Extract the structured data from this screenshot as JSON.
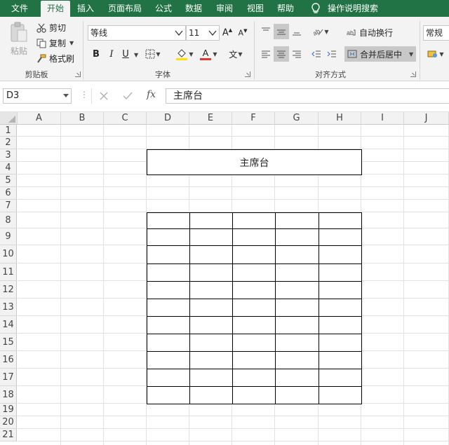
{
  "menu": {
    "file": "文件",
    "home": "开始",
    "insert": "插入",
    "page_layout": "页面布局",
    "formulas": "公式",
    "data": "数据",
    "review": "审阅",
    "view": "视图",
    "help": "帮助",
    "tell_me": "操作说明搜索"
  },
  "clipboard": {
    "paste": "粘贴",
    "cut": "剪切",
    "copy": "复制",
    "format_painter": "格式刷",
    "group_label": "剪贴板"
  },
  "font": {
    "font_name": "等线",
    "font_size": "11",
    "bold": "B",
    "italic": "I",
    "underline": "U",
    "group_label": "字体",
    "font_color": "#e03a2f",
    "fill_color": "#ffe100"
  },
  "alignment": {
    "wrap_text": "自动换行",
    "merge_center": "合并后居中",
    "group_label": "对齐方式"
  },
  "number": {
    "format": "常规"
  },
  "formula_bar": {
    "name_box": "D3",
    "content": "主席台"
  },
  "sheet": {
    "columns": [
      "A",
      "B",
      "C",
      "D",
      "E",
      "F",
      "G",
      "H",
      "I",
      "J"
    ],
    "rows": [
      "1",
      "2",
      "3",
      "4",
      "5",
      "6",
      "7",
      "8",
      "9",
      "10",
      "11",
      "12",
      "13",
      "14",
      "15",
      "16",
      "17",
      "18",
      "19",
      "20",
      "21"
    ],
    "podium_text": "主席台"
  },
  "colors": {
    "accent": "#217346"
  }
}
